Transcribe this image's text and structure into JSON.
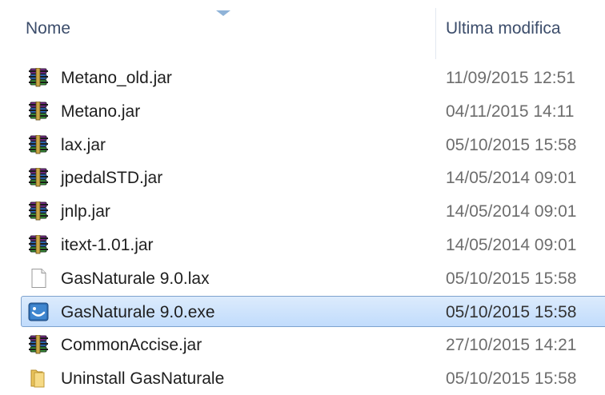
{
  "header": {
    "name_label": "Nome",
    "date_label": "Ultima modifica"
  },
  "files": [
    {
      "name": "Metano_old.jar",
      "date": "11/09/2015 12:51",
      "icon": "winrar-archive-icon"
    },
    {
      "name": "Metano.jar",
      "date": "04/11/2015 14:11",
      "icon": "winrar-archive-icon"
    },
    {
      "name": "lax.jar",
      "date": "05/10/2015 15:58",
      "icon": "winrar-archive-icon"
    },
    {
      "name": "jpedalSTD.jar",
      "date": "14/05/2014 09:01",
      "icon": "winrar-archive-icon"
    },
    {
      "name": "jnlp.jar",
      "date": "14/05/2014 09:01",
      "icon": "winrar-archive-icon"
    },
    {
      "name": "itext-1.01.jar",
      "date": "14/05/2014 09:01",
      "icon": "winrar-archive-icon"
    },
    {
      "name": "GasNaturale 9.0.lax",
      "date": "05/10/2015 15:58",
      "icon": "blank-file-icon"
    },
    {
      "name": "GasNaturale 9.0.exe",
      "date": "05/10/2015 15:58",
      "icon": "installer-exe-icon",
      "selected": true
    },
    {
      "name": "CommonAccise.jar",
      "date": "27/10/2015 14:21",
      "icon": "winrar-archive-icon"
    },
    {
      "name": "Uninstall GasNaturale",
      "date": "05/10/2015 15:58",
      "icon": "folder-icon"
    }
  ],
  "colors": {
    "header_text": "#3c4d6b",
    "selection_border": "#7da2ce",
    "selection_fill": "#cde3fc",
    "date_text": "#6d6d6d"
  }
}
